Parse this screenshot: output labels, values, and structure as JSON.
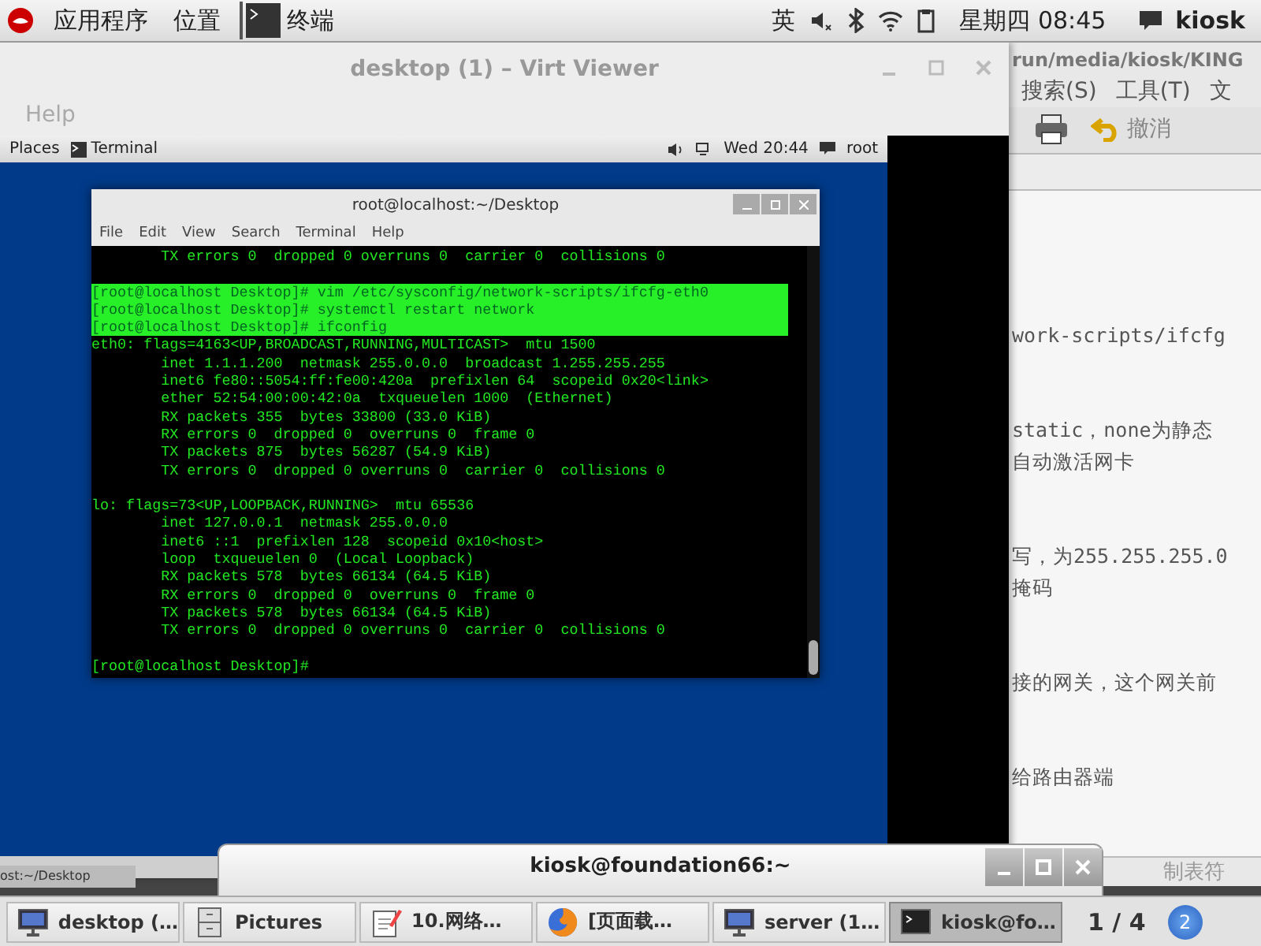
{
  "top_bar": {
    "menus": [
      "应用程序",
      "位置"
    ],
    "active_app": "终端",
    "input_method": "英",
    "clock": "星期四 08:45",
    "user": "kiosk"
  },
  "background_window": {
    "title": "run/media/kiosk/KING",
    "menus": [
      "搜索(S)",
      "工具(T)",
      "文"
    ],
    "undo_label": "撤消",
    "paragraphs": [
      [
        "work-scripts/ifcfg"
      ],
      [
        "static，none为静态",
        "自动激活网卡"
      ],
      [
        "写，为255.255.255.0",
        "掩码"
      ],
      [
        "接的网关，这个网关前"
      ],
      [
        "给路由器端"
      ]
    ],
    "status": "制表符"
  },
  "virt_viewer": {
    "title": "desktop (1) – Virt Viewer",
    "menus": [
      "Help"
    ],
    "guest": {
      "top_bar": {
        "places": "Places",
        "app": "Terminal",
        "clock": "Wed 20:44",
        "user": "root"
      },
      "terminal": {
        "title": "root@localhost:~/Desktop",
        "menus": [
          "File",
          "Edit",
          "View",
          "Search",
          "Terminal",
          "Help"
        ],
        "blocks": [
          [
            {
              "text": "        TX errors 0  dropped 0 overruns 0  carrier 0  collisions 0",
              "highlighted": false
            }
          ],
          [
            {
              "text": "[root@localhost Desktop]# vim /etc/sysconfig/network-scripts/ifcfg-eth0",
              "highlighted": true
            },
            {
              "text": "[root@localhost Desktop]# systemctl restart network",
              "highlighted": true
            },
            {
              "text": "[root@localhost Desktop]# ifconfig ",
              "highlighted": true
            },
            {
              "text": "eth0: flags=4163<UP,BROADCAST,RUNNING,MULTICAST>  mtu 1500",
              "highlighted": false
            },
            {
              "text": "        inet 1.1.1.200  netmask 255.0.0.0  broadcast 1.255.255.255",
              "highlighted": false
            },
            {
              "text": "        inet6 fe80::5054:ff:fe00:420a  prefixlen 64  scopeid 0x20<link>",
              "highlighted": false
            },
            {
              "text": "        ether 52:54:00:00:42:0a  txqueuelen 1000  (Ethernet)",
              "highlighted": false
            },
            {
              "text": "        RX packets 355  bytes 33800 (33.0 KiB)",
              "highlighted": false
            },
            {
              "text": "        RX errors 0  dropped 0  overruns 0  frame 0",
              "highlighted": false
            },
            {
              "text": "        TX packets 875  bytes 56287 (54.9 KiB)",
              "highlighted": false
            },
            {
              "text": "        TX errors 0  dropped 0 overruns 0  carrier 0  collisions 0",
              "highlighted": false
            }
          ],
          [
            {
              "text": "lo: flags=73<UP,LOOPBACK,RUNNING>  mtu 65536",
              "highlighted": false
            },
            {
              "text": "        inet 127.0.0.1  netmask 255.0.0.0",
              "highlighted": false
            },
            {
              "text": "        inet6 ::1  prefixlen 128  scopeid 0x10<host>",
              "highlighted": false
            },
            {
              "text": "        loop  txqueuelen 0  (Local Loopback)",
              "highlighted": false
            },
            {
              "text": "        RX packets 578  bytes 66134 (64.5 KiB)",
              "highlighted": false
            },
            {
              "text": "        RX errors 0  dropped 0  overruns 0  frame 0",
              "highlighted": false
            },
            {
              "text": "        TX packets 578  bytes 66134 (64.5 KiB)",
              "highlighted": false
            },
            {
              "text": "        TX errors 0  dropped 0 overruns 0  carrier 0  collisions 0",
              "highlighted": false
            }
          ],
          [
            {
              "text": "[root@localhost Desktop]#",
              "highlighted": false
            }
          ]
        ]
      },
      "taskbar_item": "ost:~/Desktop"
    }
  },
  "host_terminal": {
    "title": "kiosk@foundation66:~"
  },
  "taskbar": {
    "items": [
      {
        "label": "desktop (…",
        "kind": "monitor",
        "selected": false
      },
      {
        "label": "Pictures",
        "kind": "cabinet",
        "selected": false
      },
      {
        "label": "10.网络…",
        "kind": "notepad",
        "selected": false
      },
      {
        "label": "[页面载…",
        "kind": "browser",
        "selected": false
      },
      {
        "label": "server (1…",
        "kind": "monitor",
        "selected": false
      },
      {
        "label": "kiosk@fo…",
        "kind": "terminal",
        "selected": true
      }
    ],
    "workspace": "1 / 4",
    "notifications": "2"
  }
}
